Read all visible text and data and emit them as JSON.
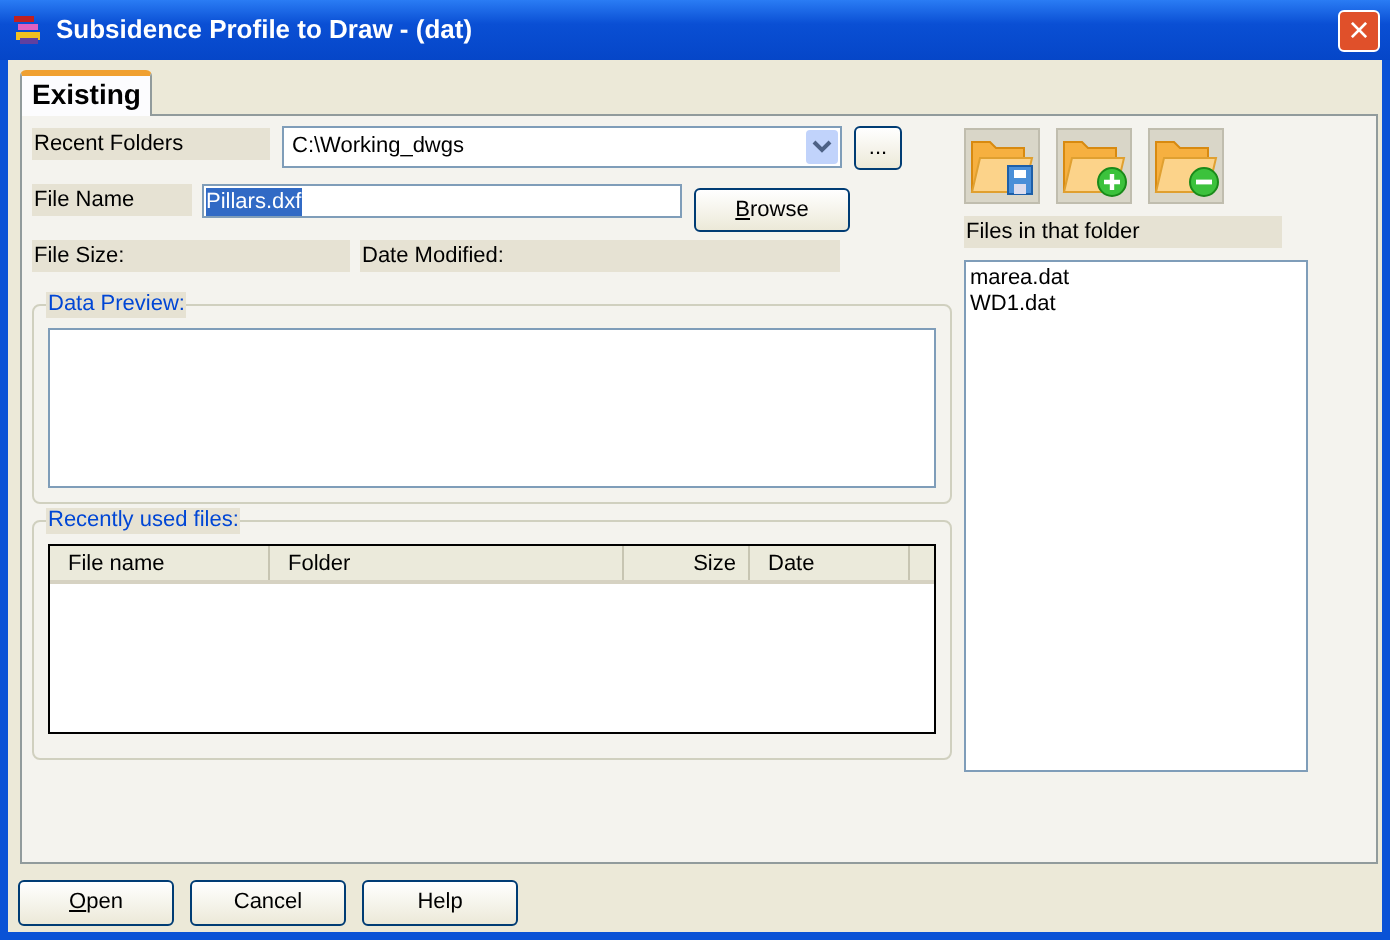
{
  "window": {
    "title": "Subsidence Profile to Draw - (dat)",
    "close": "×"
  },
  "tabs": [
    {
      "label": "Existing",
      "selected": true
    }
  ],
  "recent_folders": {
    "label": "Recent Folders",
    "value": "C:\\Working_dwgs",
    "browse_button": "..."
  },
  "file_name": {
    "label": "File Name",
    "value": "Pillars.dxf",
    "text_selected": true,
    "browse_button": {
      "label": "Browse",
      "mnemonic": true
    }
  },
  "file_size": {
    "label": "File Size:"
  },
  "date_modified": {
    "label": "Date Modified:"
  },
  "data_preview": {
    "title": "Data Preview:"
  },
  "recently_used": {
    "title": "Recently used files:",
    "columns": [
      {
        "label": "File name",
        "kind": "text"
      },
      {
        "label": "Folder",
        "kind": "text"
      },
      {
        "label": "Size",
        "kind": "number"
      },
      {
        "label": "Date",
        "kind": "text"
      }
    ]
  },
  "folder_tools": [
    {
      "kind": "save"
    },
    {
      "kind": "add"
    },
    {
      "kind": "remove"
    }
  ],
  "files_in_folder": {
    "label": "Files in that folder",
    "items": [
      "marea.dat",
      "WD1.dat"
    ]
  },
  "buttons": [
    {
      "label": "Open",
      "mnemonic": true
    },
    {
      "label": "Cancel",
      "mnemonic": false
    },
    {
      "label": "Help",
      "mnemonic": false
    }
  ]
}
